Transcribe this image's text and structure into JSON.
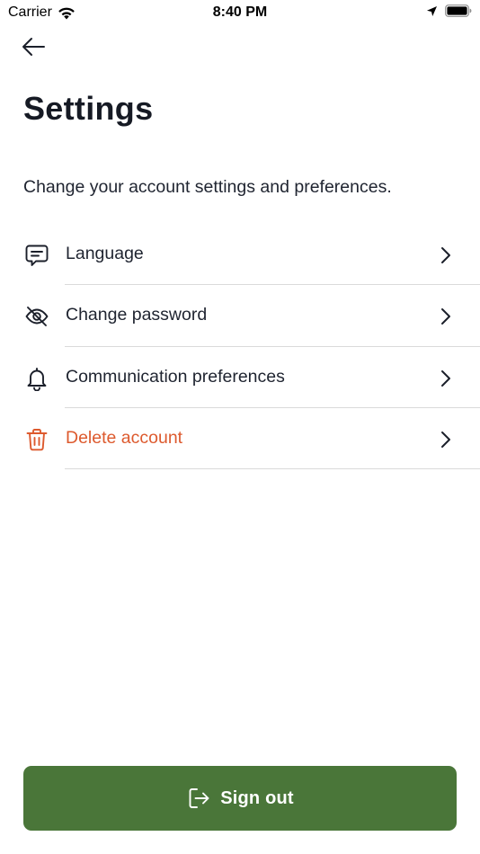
{
  "status_bar": {
    "carrier": "Carrier",
    "time": "8:40 PM"
  },
  "header": {
    "back_icon": "arrow-left-icon",
    "title": "Settings",
    "subtitle": "Change your account settings and preferences."
  },
  "settings": {
    "items": [
      {
        "label": "Language",
        "icon": "chat-bubble-icon"
      },
      {
        "label": "Change password",
        "icon": "eye-off-icon"
      },
      {
        "label": "Communication preferences",
        "icon": "bell-icon"
      },
      {
        "label": "Delete account",
        "icon": "trash-icon",
        "color": "#dd5a2e"
      }
    ]
  },
  "footer": {
    "sign_out_label": "Sign out",
    "sign_out_icon": "sign-out-icon",
    "button_color": "#4a7639"
  }
}
